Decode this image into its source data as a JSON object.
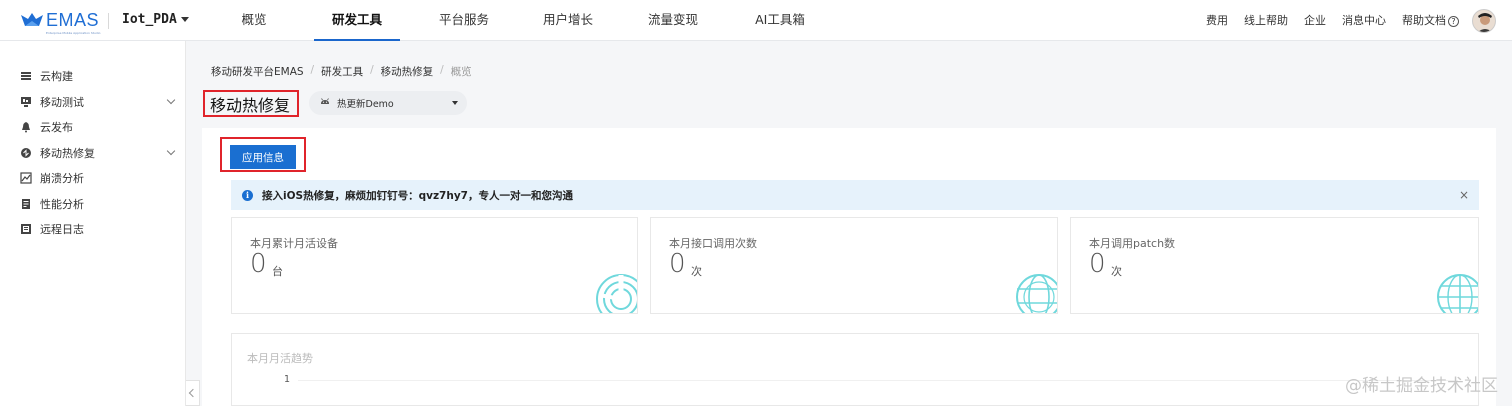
{
  "topnav": {
    "logo_text": "EMAS",
    "logo_sub": "Enterprise Mobile Application Studio",
    "app_name": "Iot_PDA",
    "tabs": [
      {
        "label": "概览"
      },
      {
        "label": "研发工具",
        "active": true
      },
      {
        "label": "平台服务"
      },
      {
        "label": "用户增长"
      },
      {
        "label": "流量变现"
      },
      {
        "label": "AI工具箱"
      }
    ],
    "links": {
      "billing": "费用",
      "online_help": "线上帮助",
      "enterprise": "企业",
      "messages": "消息中心",
      "docs": "帮助文档"
    }
  },
  "sidebar": {
    "items": [
      {
        "label": "云构建",
        "icon": "build-icon"
      },
      {
        "label": "移动测试",
        "icon": "monitor-icon",
        "expandable": true
      },
      {
        "label": "云发布",
        "icon": "bell-icon"
      },
      {
        "label": "移动热修复",
        "icon": "hotfix-icon",
        "expandable": true
      },
      {
        "label": "崩溃分析",
        "icon": "chart-icon"
      },
      {
        "label": "性能分析",
        "icon": "doc-icon"
      },
      {
        "label": "远程日志",
        "icon": "log-icon"
      }
    ]
  },
  "breadcrumb": [
    "移动研发平台EMAS",
    "研发工具",
    "移动热修复",
    "概览"
  ],
  "page": {
    "title": "移动热修复",
    "app_select": "热更新Demo",
    "app_info_button": "应用信息"
  },
  "alert": {
    "text": "接入iOS热修复，麻烦加钉钉号：qvz7hy7，专人一对一和您沟通",
    "close": "×"
  },
  "stats": [
    {
      "title": "本月累计月活设备",
      "value": "0",
      "unit": "台"
    },
    {
      "title": "本月接口调用次数",
      "value": "0",
      "unit": "次"
    },
    {
      "title": "本月调用patch数",
      "value": "0",
      "unit": "次"
    }
  ],
  "trend": {
    "title": "本月月活趋势",
    "y_tick": "1"
  },
  "watermark": "@稀土掘金技术社区",
  "colors": {
    "primary": "#1a6fd1",
    "highlight_border": "#e0242b",
    "alert_bg": "#e6f2fb",
    "deco_cyan": "#5fd3d8"
  }
}
